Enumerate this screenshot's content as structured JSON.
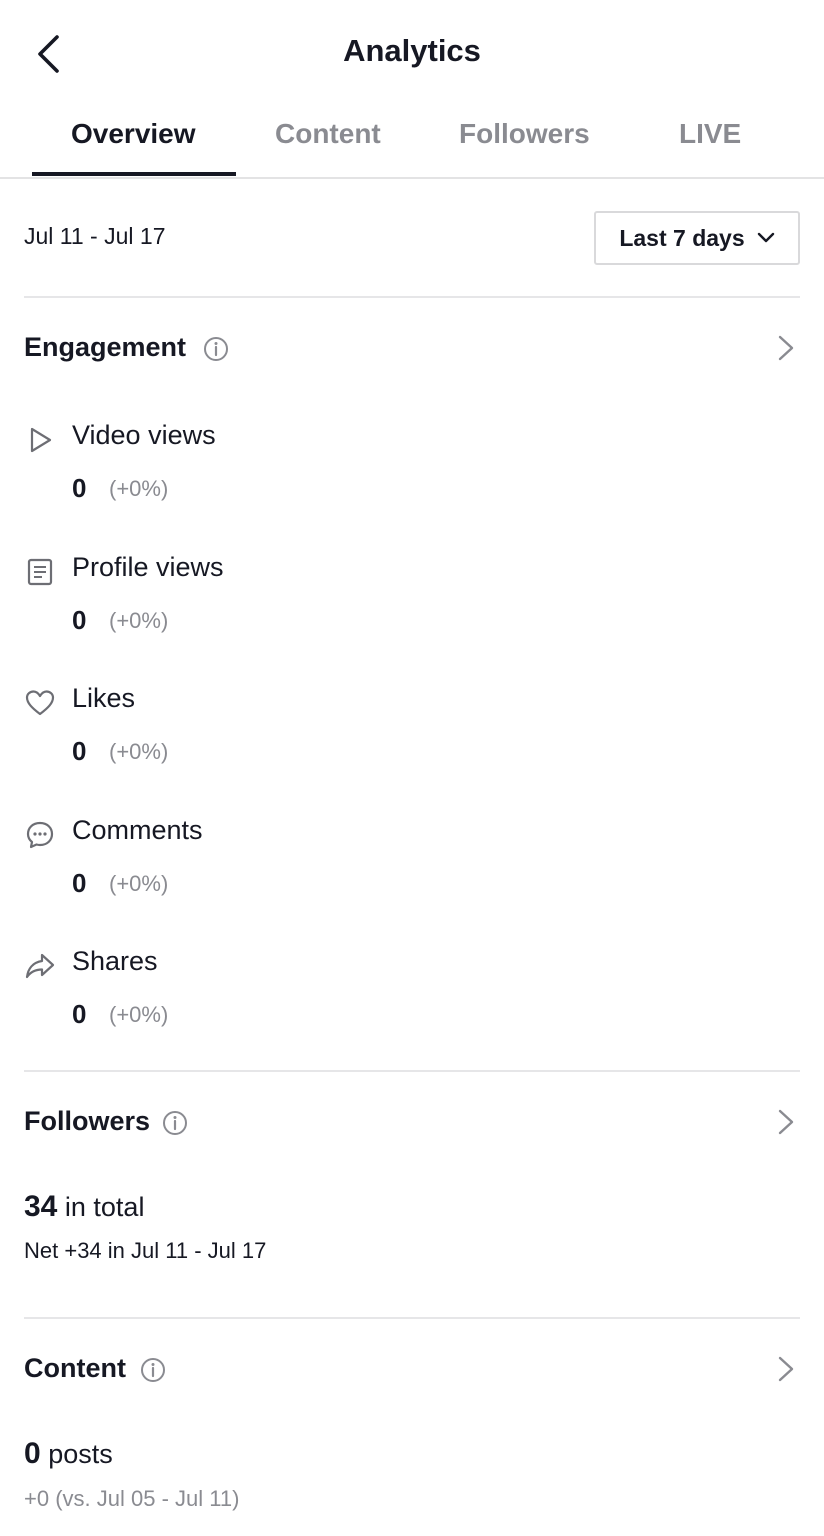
{
  "header": {
    "title": "Analytics"
  },
  "tabs": [
    {
      "label": "Overview",
      "active": true
    },
    {
      "label": "Content",
      "active": false
    },
    {
      "label": "Followers",
      "active": false
    },
    {
      "label": "LIVE",
      "active": false
    }
  ],
  "date_range": "Jul 11 - Jul 17",
  "period_select": {
    "value": "Last 7 days"
  },
  "engagement": {
    "title": "Engagement",
    "metrics": [
      {
        "icon": "play-icon",
        "label": "Video views",
        "value": "0",
        "change": "(+0%)"
      },
      {
        "icon": "profile-doc-icon",
        "label": "Profile views",
        "value": "0",
        "change": "(+0%)"
      },
      {
        "icon": "heart-icon",
        "label": "Likes",
        "value": "0",
        "change": "(+0%)"
      },
      {
        "icon": "comment-icon",
        "label": "Comments",
        "value": "0",
        "change": "(+0%)"
      },
      {
        "icon": "share-icon",
        "label": "Shares",
        "value": "0",
        "change": "(+0%)"
      }
    ]
  },
  "followers": {
    "title": "Followers",
    "total_value": "34",
    "total_suffix": "in total",
    "net": "Net +34 in Jul 11 - Jul 17"
  },
  "content": {
    "title": "Content",
    "posts_value": "0",
    "posts_suffix": "posts",
    "comparison": "+0 (vs. Jul 05 - Jul 11)"
  },
  "colors": {
    "text_primary": "#161823",
    "text_muted": "#8a8b91",
    "divider": "#e6e6e8"
  }
}
